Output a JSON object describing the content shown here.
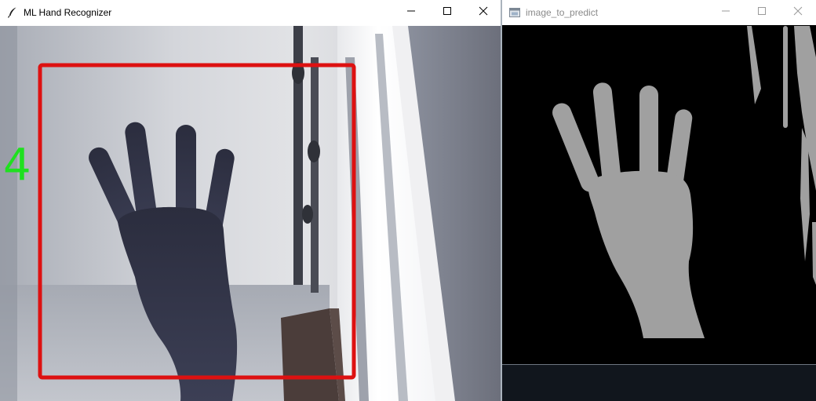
{
  "windows": [
    {
      "title": "ML Hand Recognizer",
      "icon": "feather-icon",
      "controls": [
        "minimize-icon",
        "maximize-icon",
        "close-icon"
      ]
    },
    {
      "title": "image_to_predict",
      "icon": "window-app-icon",
      "controls": [
        "minimize-icon",
        "maximize-icon",
        "close-icon"
      ]
    }
  ],
  "prediction": {
    "value": "4",
    "color": "#1fe01f"
  },
  "roi_box": {
    "color": "#dd1111"
  },
  "mask": {
    "foreground_color": "#a0a0a0",
    "background_color": "#000000"
  }
}
